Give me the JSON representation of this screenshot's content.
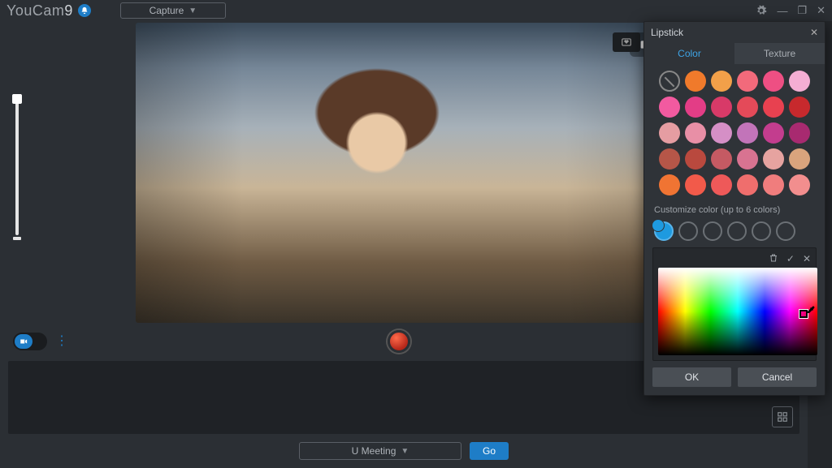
{
  "app": {
    "name": "YouCam",
    "version": "9",
    "mode": "Capture"
  },
  "window": {
    "gear": "⚙",
    "min": "—",
    "max": "❐",
    "close": "✕"
  },
  "controls": {
    "layers": "layers",
    "contrast": "contrast",
    "undo": "↺"
  },
  "bottom": {
    "meeting": "U Meeting",
    "go": "Go"
  },
  "panel": {
    "title": "Lipstick",
    "tabs": {
      "color": "Color",
      "texture": "Texture"
    },
    "customize_label": "Customize color (up to 6 colors)",
    "ok": "OK",
    "cancel": "Cancel",
    "swatches": [
      null,
      "#f07a2b",
      "#f2a049",
      "#f26a7b",
      "#ee4f83",
      "#f4aed3",
      "#f25aa0",
      "#e33d86",
      "#d83a68",
      "#e44a59",
      "#e84150",
      "#c7292d",
      "#e59da2",
      "#e88fa6",
      "#d58fc6",
      "#c274b9",
      "#c33d8e",
      "#a82a70",
      "#b65648",
      "#b9493e",
      "#c55a63",
      "#d87391",
      "#e6a3a0",
      "#d9a47d",
      "#f07433",
      "#f25a4a",
      "#ee5959",
      "#ef6e6d",
      "#f07d7d",
      "#f28e8e"
    ]
  }
}
